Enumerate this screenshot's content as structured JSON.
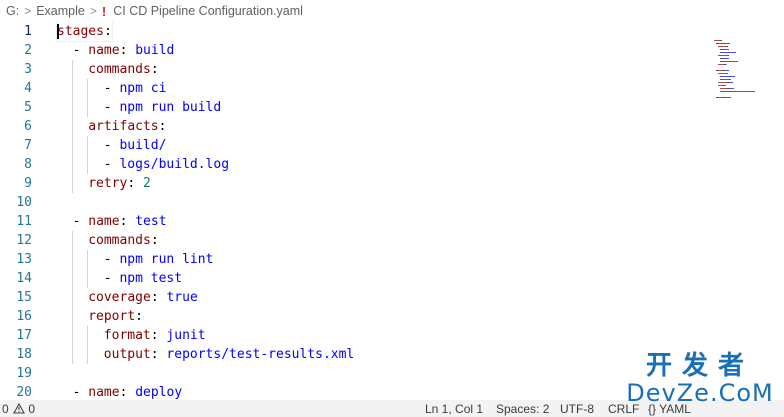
{
  "breadcrumb": {
    "drive": "G:",
    "sep": ">",
    "folder": "Example",
    "icon_glyph": "!",
    "file": "CI CD Pipeline Configuration.yaml"
  },
  "editor": {
    "active_line": 1,
    "lines": [
      {
        "n": "1",
        "indent": 0,
        "tokens": [
          {
            "t": "key",
            "v": "stages"
          },
          {
            "t": "punc",
            "v": ":"
          }
        ]
      },
      {
        "n": "2",
        "indent": 1,
        "tokens": [
          {
            "t": "punc",
            "v": "- "
          },
          {
            "t": "key",
            "v": "name"
          },
          {
            "t": "punc",
            "v": ": "
          },
          {
            "t": "val",
            "v": "build"
          }
        ]
      },
      {
        "n": "3",
        "indent": 2,
        "tokens": [
          {
            "t": "key",
            "v": "commands"
          },
          {
            "t": "punc",
            "v": ":"
          }
        ]
      },
      {
        "n": "4",
        "indent": 3,
        "tokens": [
          {
            "t": "punc",
            "v": "- "
          },
          {
            "t": "val",
            "v": "npm ci"
          }
        ]
      },
      {
        "n": "5",
        "indent": 3,
        "tokens": [
          {
            "t": "punc",
            "v": "- "
          },
          {
            "t": "val",
            "v": "npm run build"
          }
        ]
      },
      {
        "n": "6",
        "indent": 2,
        "tokens": [
          {
            "t": "key",
            "v": "artifacts"
          },
          {
            "t": "punc",
            "v": ":"
          }
        ]
      },
      {
        "n": "7",
        "indent": 3,
        "tokens": [
          {
            "t": "punc",
            "v": "- "
          },
          {
            "t": "val",
            "v": "build/"
          }
        ]
      },
      {
        "n": "8",
        "indent": 3,
        "tokens": [
          {
            "t": "punc",
            "v": "- "
          },
          {
            "t": "val",
            "v": "logs/build.log"
          }
        ]
      },
      {
        "n": "9",
        "indent": 2,
        "tokens": [
          {
            "t": "key",
            "v": "retry"
          },
          {
            "t": "punc",
            "v": ": "
          },
          {
            "t": "num",
            "v": "2"
          }
        ]
      },
      {
        "n": "10",
        "indent": 0,
        "tokens": []
      },
      {
        "n": "11",
        "indent": 1,
        "tokens": [
          {
            "t": "punc",
            "v": "- "
          },
          {
            "t": "key",
            "v": "name"
          },
          {
            "t": "punc",
            "v": ": "
          },
          {
            "t": "val",
            "v": "test"
          }
        ]
      },
      {
        "n": "12",
        "indent": 2,
        "tokens": [
          {
            "t": "key",
            "v": "commands"
          },
          {
            "t": "punc",
            "v": ":"
          }
        ]
      },
      {
        "n": "13",
        "indent": 3,
        "tokens": [
          {
            "t": "punc",
            "v": "- "
          },
          {
            "t": "val",
            "v": "npm run lint"
          }
        ]
      },
      {
        "n": "14",
        "indent": 3,
        "tokens": [
          {
            "t": "punc",
            "v": "- "
          },
          {
            "t": "val",
            "v": "npm test"
          }
        ]
      },
      {
        "n": "15",
        "indent": 2,
        "tokens": [
          {
            "t": "key",
            "v": "coverage"
          },
          {
            "t": "punc",
            "v": ": "
          },
          {
            "t": "bool",
            "v": "true"
          }
        ]
      },
      {
        "n": "16",
        "indent": 2,
        "tokens": [
          {
            "t": "key",
            "v": "report"
          },
          {
            "t": "punc",
            "v": ":"
          }
        ]
      },
      {
        "n": "17",
        "indent": 3,
        "tokens": [
          {
            "t": "key",
            "v": "format"
          },
          {
            "t": "punc",
            "v": ": "
          },
          {
            "t": "val",
            "v": "junit"
          }
        ]
      },
      {
        "n": "18",
        "indent": 3,
        "tokens": [
          {
            "t": "key",
            "v": "output"
          },
          {
            "t": "punc",
            "v": ": "
          },
          {
            "t": "val",
            "v": "reports/test-results.xml"
          }
        ]
      },
      {
        "n": "19",
        "indent": 0,
        "tokens": []
      },
      {
        "n": "20",
        "indent": 1,
        "tokens": [
          {
            "t": "punc",
            "v": "- "
          },
          {
            "t": "key",
            "v": "name"
          },
          {
            "t": "punc",
            "v": ": "
          },
          {
            "t": "val",
            "v": "deploy"
          }
        ]
      }
    ]
  },
  "status_bar": {
    "errors": "0",
    "warnings": "0",
    "position": "Ln 1, Col 1",
    "spaces": "Spaces: 2",
    "encoding": "UTF-8",
    "eol": "CRLF",
    "language_glyph": "{}",
    "language": "YAML"
  },
  "watermark": {
    "cn": "开发者",
    "en": "DevZe.CoM"
  },
  "colors": {
    "key": "#800000",
    "value": "#0000ff",
    "number": "#098658",
    "line_number": "#237893",
    "status_bg": "#f3f3f3",
    "watermark": "#1b6fb6"
  },
  "icons": [
    "chevron-right-icon",
    "yaml-file-icon",
    "warning-icon",
    "copilot-icon",
    "notifications-icon"
  ]
}
